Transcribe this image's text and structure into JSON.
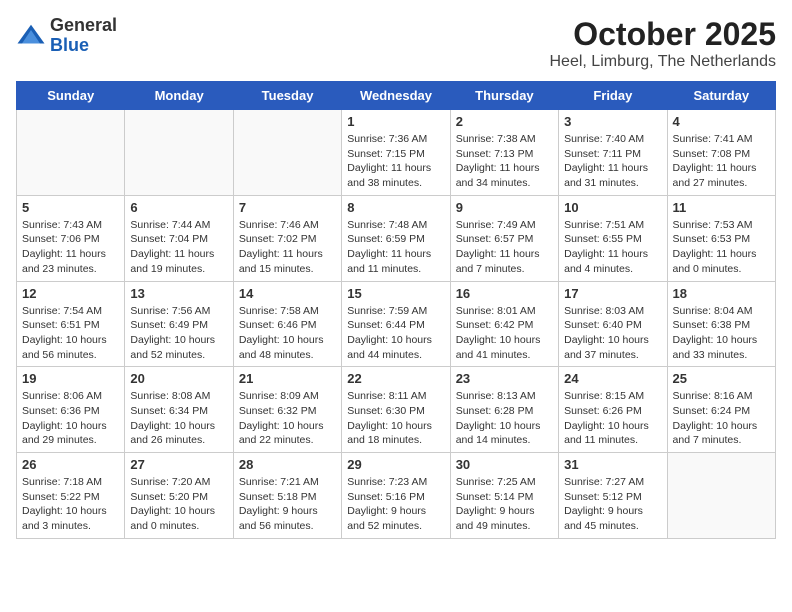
{
  "header": {
    "logo_general": "General",
    "logo_blue": "Blue",
    "title": "October 2025",
    "subtitle": "Heel, Limburg, The Netherlands"
  },
  "weekdays": [
    "Sunday",
    "Monday",
    "Tuesday",
    "Wednesday",
    "Thursday",
    "Friday",
    "Saturday"
  ],
  "weeks": [
    [
      {
        "day": "",
        "info": ""
      },
      {
        "day": "",
        "info": ""
      },
      {
        "day": "",
        "info": ""
      },
      {
        "day": "1",
        "info": "Sunrise: 7:36 AM\nSunset: 7:15 PM\nDaylight: 11 hours\nand 38 minutes."
      },
      {
        "day": "2",
        "info": "Sunrise: 7:38 AM\nSunset: 7:13 PM\nDaylight: 11 hours\nand 34 minutes."
      },
      {
        "day": "3",
        "info": "Sunrise: 7:40 AM\nSunset: 7:11 PM\nDaylight: 11 hours\nand 31 minutes."
      },
      {
        "day": "4",
        "info": "Sunrise: 7:41 AM\nSunset: 7:08 PM\nDaylight: 11 hours\nand 27 minutes."
      }
    ],
    [
      {
        "day": "5",
        "info": "Sunrise: 7:43 AM\nSunset: 7:06 PM\nDaylight: 11 hours\nand 23 minutes."
      },
      {
        "day": "6",
        "info": "Sunrise: 7:44 AM\nSunset: 7:04 PM\nDaylight: 11 hours\nand 19 minutes."
      },
      {
        "day": "7",
        "info": "Sunrise: 7:46 AM\nSunset: 7:02 PM\nDaylight: 11 hours\nand 15 minutes."
      },
      {
        "day": "8",
        "info": "Sunrise: 7:48 AM\nSunset: 6:59 PM\nDaylight: 11 hours\nand 11 minutes."
      },
      {
        "day": "9",
        "info": "Sunrise: 7:49 AM\nSunset: 6:57 PM\nDaylight: 11 hours\nand 7 minutes."
      },
      {
        "day": "10",
        "info": "Sunrise: 7:51 AM\nSunset: 6:55 PM\nDaylight: 11 hours\nand 4 minutes."
      },
      {
        "day": "11",
        "info": "Sunrise: 7:53 AM\nSunset: 6:53 PM\nDaylight: 11 hours\nand 0 minutes."
      }
    ],
    [
      {
        "day": "12",
        "info": "Sunrise: 7:54 AM\nSunset: 6:51 PM\nDaylight: 10 hours\nand 56 minutes."
      },
      {
        "day": "13",
        "info": "Sunrise: 7:56 AM\nSunset: 6:49 PM\nDaylight: 10 hours\nand 52 minutes."
      },
      {
        "day": "14",
        "info": "Sunrise: 7:58 AM\nSunset: 6:46 PM\nDaylight: 10 hours\nand 48 minutes."
      },
      {
        "day": "15",
        "info": "Sunrise: 7:59 AM\nSunset: 6:44 PM\nDaylight: 10 hours\nand 44 minutes."
      },
      {
        "day": "16",
        "info": "Sunrise: 8:01 AM\nSunset: 6:42 PM\nDaylight: 10 hours\nand 41 minutes."
      },
      {
        "day": "17",
        "info": "Sunrise: 8:03 AM\nSunset: 6:40 PM\nDaylight: 10 hours\nand 37 minutes."
      },
      {
        "day": "18",
        "info": "Sunrise: 8:04 AM\nSunset: 6:38 PM\nDaylight: 10 hours\nand 33 minutes."
      }
    ],
    [
      {
        "day": "19",
        "info": "Sunrise: 8:06 AM\nSunset: 6:36 PM\nDaylight: 10 hours\nand 29 minutes."
      },
      {
        "day": "20",
        "info": "Sunrise: 8:08 AM\nSunset: 6:34 PM\nDaylight: 10 hours\nand 26 minutes."
      },
      {
        "day": "21",
        "info": "Sunrise: 8:09 AM\nSunset: 6:32 PM\nDaylight: 10 hours\nand 22 minutes."
      },
      {
        "day": "22",
        "info": "Sunrise: 8:11 AM\nSunset: 6:30 PM\nDaylight: 10 hours\nand 18 minutes."
      },
      {
        "day": "23",
        "info": "Sunrise: 8:13 AM\nSunset: 6:28 PM\nDaylight: 10 hours\nand 14 minutes."
      },
      {
        "day": "24",
        "info": "Sunrise: 8:15 AM\nSunset: 6:26 PM\nDaylight: 10 hours\nand 11 minutes."
      },
      {
        "day": "25",
        "info": "Sunrise: 8:16 AM\nSunset: 6:24 PM\nDaylight: 10 hours\nand 7 minutes."
      }
    ],
    [
      {
        "day": "26",
        "info": "Sunrise: 7:18 AM\nSunset: 5:22 PM\nDaylight: 10 hours\nand 3 minutes."
      },
      {
        "day": "27",
        "info": "Sunrise: 7:20 AM\nSunset: 5:20 PM\nDaylight: 10 hours\nand 0 minutes."
      },
      {
        "day": "28",
        "info": "Sunrise: 7:21 AM\nSunset: 5:18 PM\nDaylight: 9 hours\nand 56 minutes."
      },
      {
        "day": "29",
        "info": "Sunrise: 7:23 AM\nSunset: 5:16 PM\nDaylight: 9 hours\nand 52 minutes."
      },
      {
        "day": "30",
        "info": "Sunrise: 7:25 AM\nSunset: 5:14 PM\nDaylight: 9 hours\nand 49 minutes."
      },
      {
        "day": "31",
        "info": "Sunrise: 7:27 AM\nSunset: 5:12 PM\nDaylight: 9 hours\nand 45 minutes."
      },
      {
        "day": "",
        "info": ""
      }
    ]
  ]
}
